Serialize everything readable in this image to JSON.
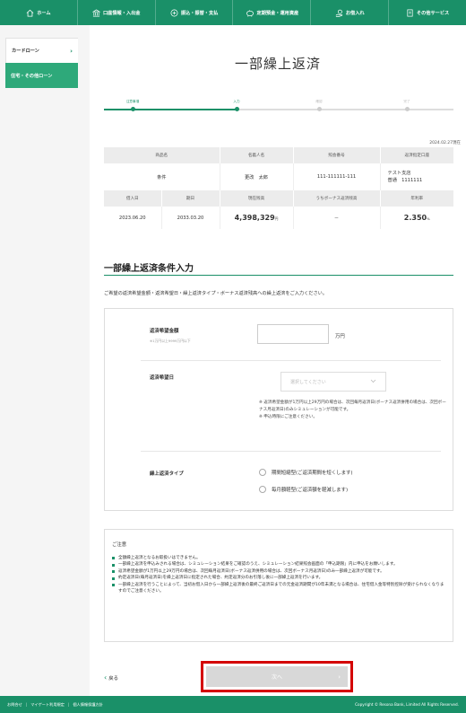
{
  "nav": [
    {
      "label": "ホーム",
      "icon": "home-icon"
    },
    {
      "label": "口座情報・入出金",
      "icon": "bank-icon"
    },
    {
      "label": "振込・振替・支払",
      "icon": "transfer-icon"
    },
    {
      "label": "定期預金・運用資産",
      "icon": "piggy-icon"
    },
    {
      "label": "お借入れ",
      "icon": "loan-icon"
    },
    {
      "label": "その他サービス",
      "icon": "document-icon"
    }
  ],
  "sidebar": {
    "items": [
      {
        "label": "カードローン"
      },
      {
        "label": "住宅・その他ローン"
      }
    ]
  },
  "page": {
    "title": "一部繰上返済"
  },
  "steps": [
    {
      "label": "注意事項"
    },
    {
      "label": "入力"
    },
    {
      "label": "確認"
    },
    {
      "label": "完了"
    }
  ],
  "summary": {
    "as_of": "2024.02.27現在",
    "headers1": [
      "商品名",
      "名義人名",
      "照会番号",
      "返済指定口座"
    ],
    "row1": {
      "product": "条件",
      "holder": "更改　太郎",
      "ref_no": "111-111111-111",
      "account_branch": "テスト支店",
      "account_no": "普通　1111111"
    },
    "headers2": [
      "借入日",
      "期日",
      "現在残高",
      "うちボーナス返済残高",
      "年利率"
    ],
    "row2": {
      "borrow_date": "2023.06.20",
      "due_date": "2033.03.20",
      "balance": "4,398,329",
      "balance_unit": "円",
      "bonus_balance": "－",
      "rate": "2.350",
      "rate_unit": "%"
    }
  },
  "section": {
    "title": "一部繰上返済条件入力",
    "instruction": "ご希望の返済希望金額・返済希望日・繰上返済タイプ・ボーナス返済残高への繰上返済をご入力ください。"
  },
  "form": {
    "amount": {
      "label": "返済希望金額",
      "sub": "※1万円以上9999万円以下",
      "value": "",
      "unit": "万円"
    },
    "date": {
      "label": "返済希望日",
      "placeholder": "選択してください",
      "notes": [
        "※ 返済希望金額が1万円以上29万円の場合は、次回毎月返済日(ボーナス返済併用の場合は、次回ボーナス月返済日)のみシミュレーションが可能です。",
        "※ 申込時限にご注意ください。"
      ]
    },
    "type": {
      "label": "繰上返済タイプ",
      "options": [
        "期間短縮型(ご返済期間を短くします)",
        "毎月額軽型(ご返済額を軽減します)"
      ]
    }
  },
  "caution": {
    "title": "ご注意",
    "items": [
      "全額繰上返済となるお取扱いはできません。",
      "一部繰上返済を申込みされる場合は、シミュレーション結果をご確認のうえ、シミュレーション結果照会画面の「申込期限」内に申込をお願いします。",
      "返済希望金額が1万円以上29万円の場合は、次回毎月返済日(ボーナス返済併用の場合は、次回ボーナス月返済日)のみ一部繰上返済が可能です。",
      "約定返済日(毎月返済日)を繰上返済日に指定された場合、約定返済分のお引落し後に一部繰上返済を行います。",
      "一部繰上返済を行うことによって、当初お借入日から一部繰上返済後の最終ご返済日までの元金返済期間が10年未満となる場合は、住宅借入金等特別控除が受けられなくなりますのでご注意ください。"
    ]
  },
  "buttons": {
    "back": "戻る",
    "next": "次へ"
  },
  "footer": {
    "links": [
      "お問合せ",
      "マイゲート利用規定",
      "個人情報保護方針"
    ],
    "copyright": "Copyright © Resona Bank, Limited All Rights Reserved."
  }
}
